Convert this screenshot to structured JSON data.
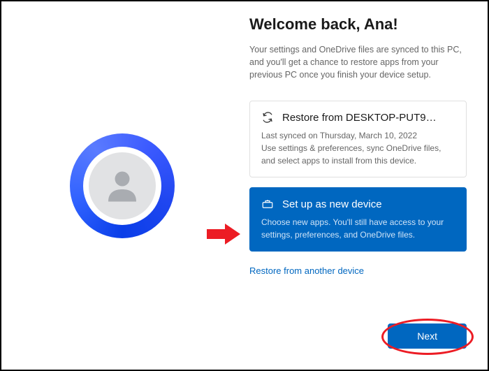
{
  "title": "Welcome back, Ana!",
  "subtitle": "Your settings and OneDrive files are synced to this PC, and you'll get a chance to restore apps from your previous PC once you finish your device setup.",
  "options": {
    "restore": {
      "title": "Restore from DESKTOP-PUT9…",
      "desc": "Last synced on Thursday, March 10, 2022\nUse settings & preferences, sync OneDrive files, and select apps to install from this device."
    },
    "new_device": {
      "title": "Set up as new device",
      "desc": "Choose new apps. You'll still have access to your settings, preferences, and OneDrive files."
    }
  },
  "restore_link": "Restore from another device",
  "next_label": "Next",
  "colors": {
    "accent": "#0067c0"
  }
}
